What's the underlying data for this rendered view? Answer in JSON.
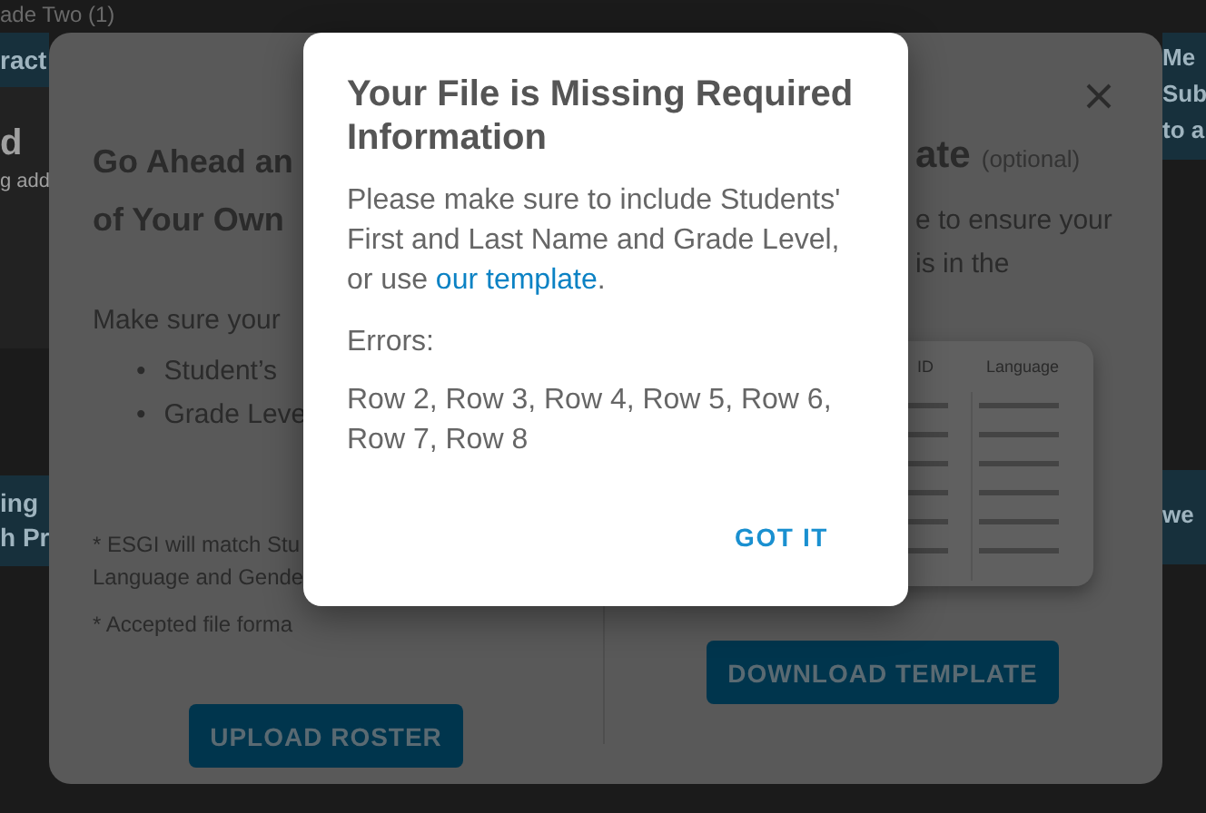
{
  "background_page": {
    "header_fragment": "ade Two (1)",
    "left_cards": [
      {
        "band": [
          "ract"
        ],
        "title": "d",
        "subtitle": "g add"
      },
      {
        "band": [
          "ing",
          "h Pr"
        ]
      }
    ],
    "right_cards": [
      {
        "band": [
          "Me",
          "Sub",
          "to a"
        ]
      },
      {
        "band": [
          "we"
        ]
      }
    ]
  },
  "roster_dialog": {
    "left": {
      "title_lines": [
        "Go Ahead an",
        "of Your Own"
      ],
      "intro": "Make sure your",
      "bullets": [
        {
          "marker": "•",
          "text": "Student’s"
        },
        {
          "marker": "•",
          "text": "Grade Leve"
        }
      ],
      "notes": [
        [
          "* ESGI will match Stu",
          "Language and Gende"
        ],
        [
          "* Accepted file forma"
        ]
      ],
      "button": "UPLOAD ROSTER"
    },
    "right": {
      "title": "ate",
      "title_note": "(optional)",
      "body_lines": [
        "e to ensure your",
        "is in the"
      ],
      "table_columns": [
        "ID",
        "Language"
      ],
      "button": "DOWNLOAD TEMPLATE"
    }
  },
  "alert": {
    "title": "Your File is Missing Required Information",
    "message": {
      "before": "Please make sure to include Students' First and Last Name and Grade Level, or use ",
      "link": "our template",
      "after": "."
    },
    "errors_label": "Errors:",
    "errors": "Row 2, Row 3, Row 4, Row 5, Row 6, Row 7, Row 8",
    "button": "GOT IT"
  }
}
